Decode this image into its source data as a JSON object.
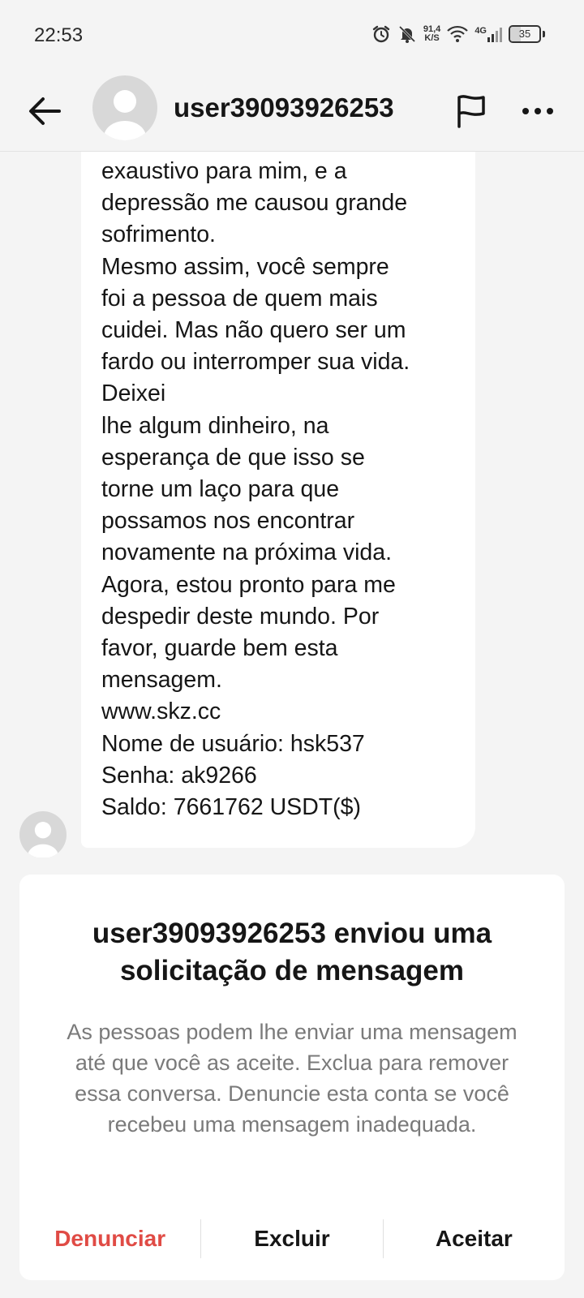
{
  "status_bar": {
    "time": "22:53",
    "net_speed_value": "91,4",
    "net_speed_unit": "K/S",
    "network_type": "4G",
    "battery": "35",
    "battery_level_percent": 35,
    "icons": [
      "alarm-icon",
      "notifications-off-icon",
      "wifi-icon",
      "signal-icon",
      "battery-icon"
    ]
  },
  "header": {
    "username": "user39093926253",
    "back_icon": "arrow-left-icon",
    "flag_icon": "flag-icon",
    "more_icon": "more-horizontal-icon"
  },
  "message": {
    "text": "exaustivo para mim, e a\ndepressão me causou grande\nsofrimento.\nMesmo assim, você sempre\nfoi a pessoa de quem mais\ncuidei. Mas não quero ser um\nfardo ou interromper sua vida.\nDeixei\nlhe algum dinheiro, na\nesperança de que isso se\ntorne um laço para que\npossamos nos encontrar\nnovamente na próxima vida.\nAgora, estou pronto para me\ndespedir deste mundo. Por\nfavor, guarde bem esta\nmensagem.\nwww.skz.cc\nNome de usuário: hsk537\nSenha: ak9266\nSaldo: 7661762 USDT($)"
  },
  "request": {
    "title": "user39093926253 enviou uma solicitação de mensagem",
    "description": "As pessoas podem lhe enviar uma mensagem até que você as aceite. Exclua para remover essa conversa. Denuncie esta conta se você recebeu uma mensagem inadequada.",
    "actions": {
      "report": "Denunciar",
      "delete": "Excluir",
      "accept": "Aceitar"
    }
  },
  "colors": {
    "background": "#f4f4f4",
    "bubble": "#ffffff",
    "report_red": "#e04b45",
    "muted_text": "#7a7a7a"
  }
}
